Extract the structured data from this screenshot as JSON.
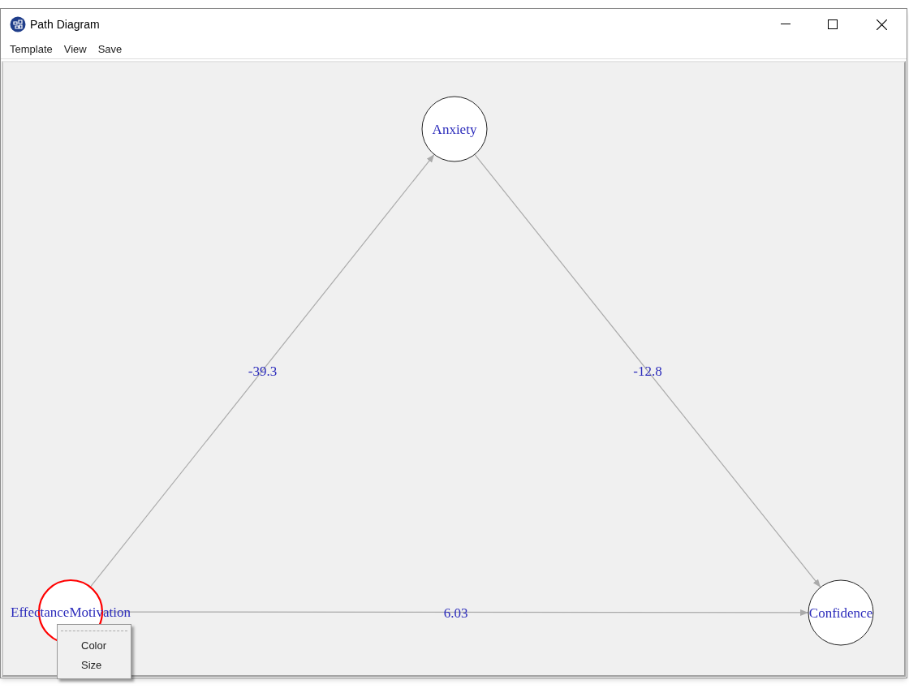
{
  "window": {
    "title": "Path Diagram"
  },
  "menu_bar": [
    "Template",
    "View",
    "Save"
  ],
  "nodes": [
    {
      "label": "Anxiety",
      "selected": false
    },
    {
      "label": "EffectanceMotivation",
      "selected": true
    },
    {
      "label": "Confidence",
      "selected": false
    }
  ],
  "edges": [
    {
      "label": "-39.3"
    },
    {
      "label": "-12.8"
    },
    {
      "label": "6.03"
    }
  ],
  "context_menu": {
    "items": [
      "Color",
      "Size"
    ]
  }
}
